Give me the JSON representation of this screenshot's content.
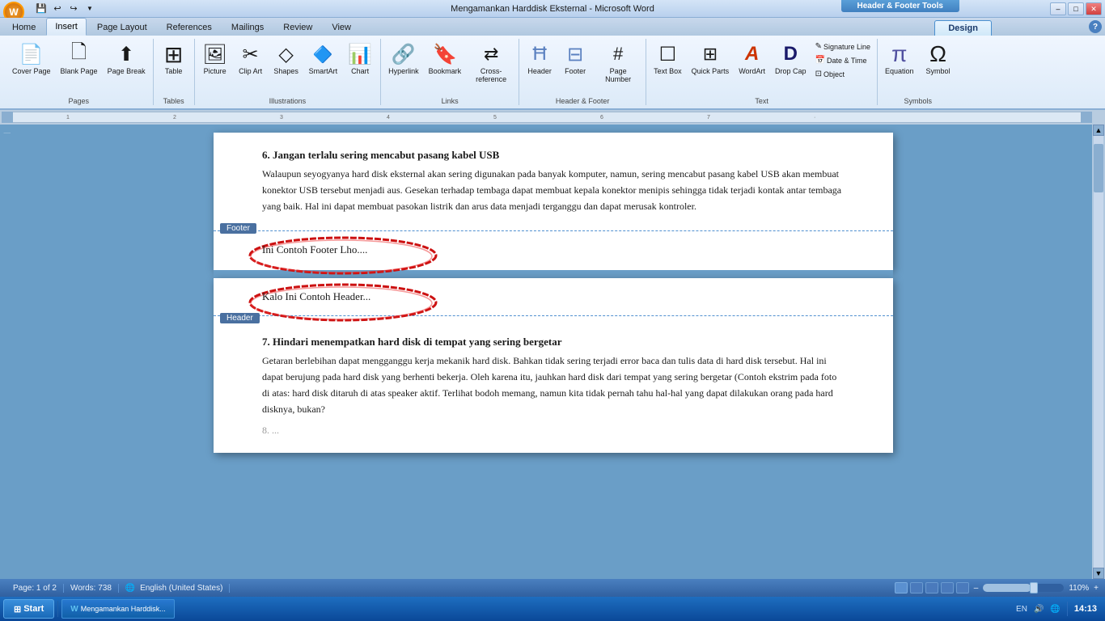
{
  "titlebar": {
    "title": "Mengamankan Harddisk Eksternal - Microsoft Word",
    "context_tab": "Header & Footer Tools",
    "min": "–",
    "max": "□",
    "close": "✕"
  },
  "tabs": {
    "items": [
      "Home",
      "Insert",
      "Page Layout",
      "References",
      "Mailings",
      "Review",
      "View"
    ],
    "active": "Insert",
    "context": "Design"
  },
  "ribbon_groups": {
    "pages": {
      "label": "Pages",
      "buttons": [
        "Cover Page",
        "Blank Page",
        "Page Break"
      ]
    },
    "tables": {
      "label": "Tables",
      "buttons": [
        "Table"
      ]
    },
    "illustrations": {
      "label": "Illustrations",
      "buttons": [
        "Picture",
        "Clip Art",
        "Shapes",
        "SmartArt",
        "Chart"
      ]
    },
    "links": {
      "label": "Links",
      "buttons": [
        "Hyperlink",
        "Bookmark",
        "Cross-reference"
      ]
    },
    "header_footer": {
      "label": "Header & Footer",
      "buttons": [
        "Header",
        "Footer",
        "Page Number"
      ]
    },
    "text": {
      "label": "Text",
      "buttons": [
        "Text Box",
        "Quick Parts",
        "WordArt",
        "Drop Cap",
        "Signature Line",
        "Date & Time",
        "Object"
      ]
    },
    "symbols": {
      "label": "Symbols",
      "buttons": [
        "Equation",
        "Symbol"
      ]
    }
  },
  "document": {
    "page1": {
      "section6_heading": "6. Jangan terlalu sering mencabut pasang kabel USB",
      "section6_body": "Walaupun seyogyanya hard disk eksternal akan sering digunakan pada banyak komputer, namun, sering mencabut pasang kabel USB akan membuat konektor USB tersebut menjadi aus. Gesekan terhadap tembaga dapat membuat kepala konektor menipis sehingga tidak terjadi kontak antar tembaga yang baik. Hal ini dapat membuat pasokan listrik dan arus data menjadi terganggu dan dapat merusak kontroler.",
      "footer_label": "Footer",
      "footer_text": "Ini Contoh Footer Lho...."
    },
    "page2": {
      "header_label": "Header",
      "header_text": "Kalo Ini Contoh Header...",
      "section7_heading": "7. Hindari menempatkan hard disk di tempat yang sering bergetar",
      "section7_body": "Getaran berlebihan dapat mengganggu kerja mekanik hard disk. Bahkan tidak sering terjadi error baca dan tulis data di hard disk tersebut. Hal ini dapat berujung pada hard disk yang berhenti bekerja. Oleh karena itu, jauhkan hard disk dari tempat yang sering bergetar (Contoh ekstrim pada foto di atas: hard disk ditaruh di atas speaker aktif. Terlihat bodoh memang, namun kita tidak pernah tahu hal-hal yang dapat dilakukan orang pada hard disknya, bukan?"
    }
  },
  "statusbar": {
    "page": "Page: 1 of 2",
    "words": "Words: 738",
    "language": "English (United States)",
    "zoom": "110%"
  },
  "taskbar": {
    "start": "Start",
    "time": "14:13",
    "apps": [
      "W"
    ]
  }
}
